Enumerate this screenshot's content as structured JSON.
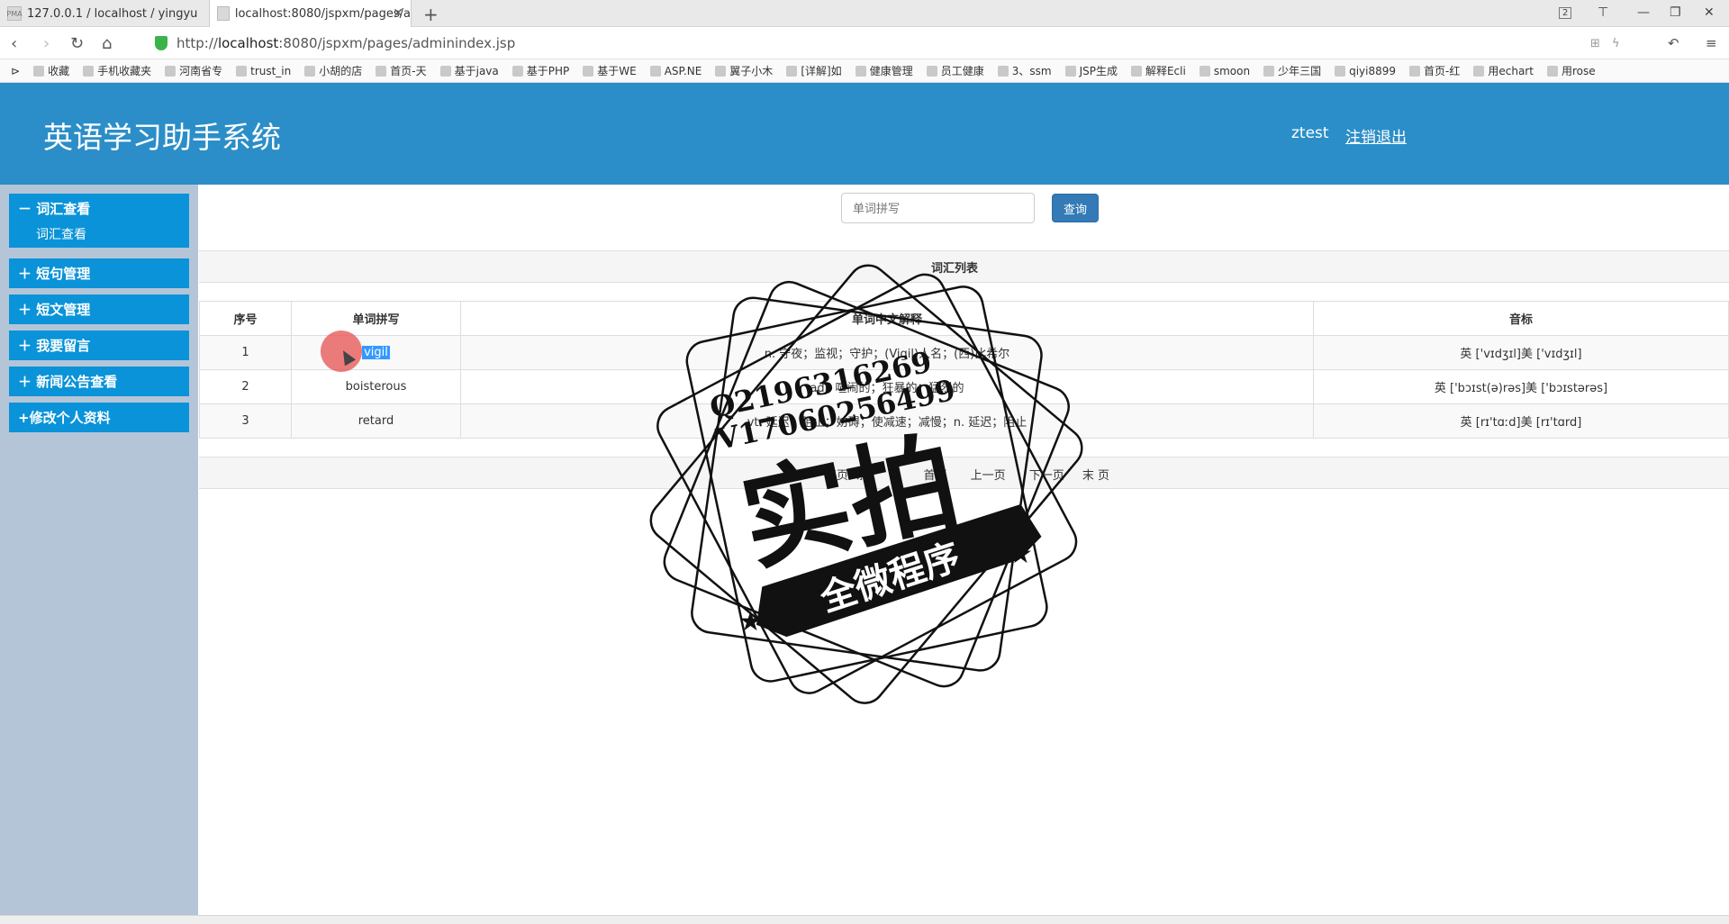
{
  "browser": {
    "tabs": [
      {
        "label": "127.0.0.1 / localhost / yingyu"
      },
      {
        "label": "localhost:8080/jspxm/pages/a"
      }
    ],
    "tab_count_badge": "2",
    "url_prefix": "http://",
    "url_host": "localhost",
    "url_rest": ":8080/jspxm/pages/adminindex.jsp",
    "bookmarks": [
      "收藏",
      "手机收藏夹",
      "河南省专",
      "trust_in",
      "小胡的店",
      "首页-天",
      "基于java",
      "基于PHP",
      "基于WE",
      "ASP.NE",
      "翼子小木",
      "[详解]如",
      "健康管理",
      "员工健康",
      "3、ssm",
      "JSP生成",
      "解释Ecli",
      "smoon",
      "少年三国",
      "qiyi8899",
      "首页-红",
      "用echart",
      "用rose"
    ]
  },
  "header": {
    "title": "英语学习助手系统",
    "user": "ztest",
    "logout": "注销退出"
  },
  "sidebar": {
    "menus": [
      {
        "label": "－ 词汇查看"
      },
      {
        "label": "＋ 短句管理"
      },
      {
        "label": "＋ 短文管理"
      },
      {
        "label": "＋ 我要留言"
      },
      {
        "label": "＋ 新闻公告查看"
      },
      {
        "label": "+修改个人资料"
      }
    ],
    "sub_item": "词汇查看"
  },
  "search": {
    "placeholder": "单词拼写",
    "button": "查询"
  },
  "list_title": "词汇列表",
  "table": {
    "headers": [
      "序号",
      "单词拼写",
      "单词中文解释",
      "音标"
    ],
    "rows": [
      {
        "no": "1",
        "word": "vigil",
        "meaning": "n. 守夜；监视；守护；(Vigil)人名；(西)比希尔",
        "phonetic": "英 ['vɪdʒɪl]美 ['vɪdʒɪl]"
      },
      {
        "no": "2",
        "word": "boisterous",
        "meaning": "adj. 喧闹的；狂暴的；猛烈的",
        "phonetic": "英 ['bɔɪst(ə)rəs]美 ['bɔɪstərəs]"
      },
      {
        "no": "3",
        "word": "retard",
        "meaning": "vt. 延迟；阻止；妨碍；使减速；减慢；n. 延迟；阻止",
        "phonetic": "英 [rɪ'tɑːd]美 [rɪ'tɑrd]"
      }
    ]
  },
  "pager": {
    "per_page_prefix": "每页",
    "per_page_count": "5",
    "per_page_suffix": "条",
    "first": "首页",
    "prev": "上一页",
    "next": "下一页",
    "last": "末 页"
  },
  "watermark": {
    "line1": "Q2196316269",
    "line2": "V17060256499",
    "big": "实拍",
    "banner": "全微程序"
  }
}
